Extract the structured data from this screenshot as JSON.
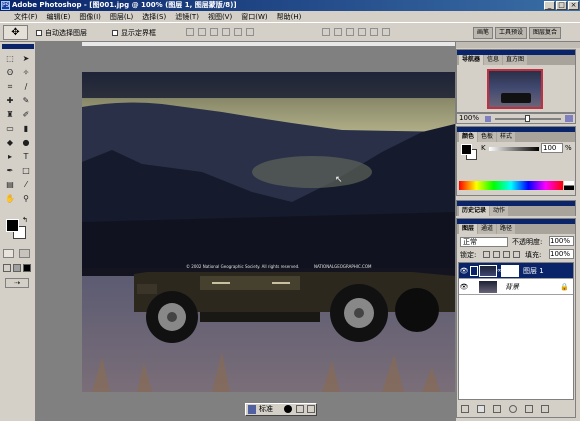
{
  "window": {
    "title": "Adobe Photoshop - [图001.jpg @ 100% (图层 1, 图层蒙版/8)]",
    "app_icon": "PS"
  },
  "window_controls": {
    "minimize": "_",
    "maximize": "□",
    "close": "×"
  },
  "menu": [
    "文件(F)",
    "编辑(E)",
    "图像(I)",
    "图层(L)",
    "选择(S)",
    "滤镜(T)",
    "视图(V)",
    "窗口(W)",
    "帮助(H)"
  ],
  "options": {
    "auto_select": "自动选择图层",
    "show_bounds": "显示定界框"
  },
  "palette_well": [
    "画笔",
    "工具预设",
    "图层复合"
  ],
  "photo": {
    "caption_left": "© 2002 National Geographic Society. All rights reserved.",
    "caption_right": "NATIONALGEOGRAPHIC.COM"
  },
  "status": {
    "mode": "标准"
  },
  "navigator": {
    "tabs": [
      "导航器",
      "信息",
      "直方图"
    ],
    "zoom": "100%"
  },
  "color_panel": {
    "tabs": [
      "颜色",
      "色板",
      "样式"
    ],
    "channel": "K",
    "value": "100",
    "unit": "%"
  },
  "history": {
    "tabs": [
      "历史记录",
      "动作"
    ]
  },
  "layers": {
    "tabs": [
      "图层",
      "通道",
      "路径"
    ],
    "blend_mode": "正常",
    "opacity_label": "不透明度:",
    "opacity_value": "100%",
    "lock_label": "锁定:",
    "fill_label": "填充:",
    "fill_value": "100%",
    "items": [
      {
        "name": "图层 1",
        "selected": true
      },
      {
        "name": "背景",
        "selected": false
      }
    ]
  },
  "colors": {
    "titlebar": "#0a246a",
    "chrome": "#d4d0c8",
    "selection": "#0a246a"
  }
}
